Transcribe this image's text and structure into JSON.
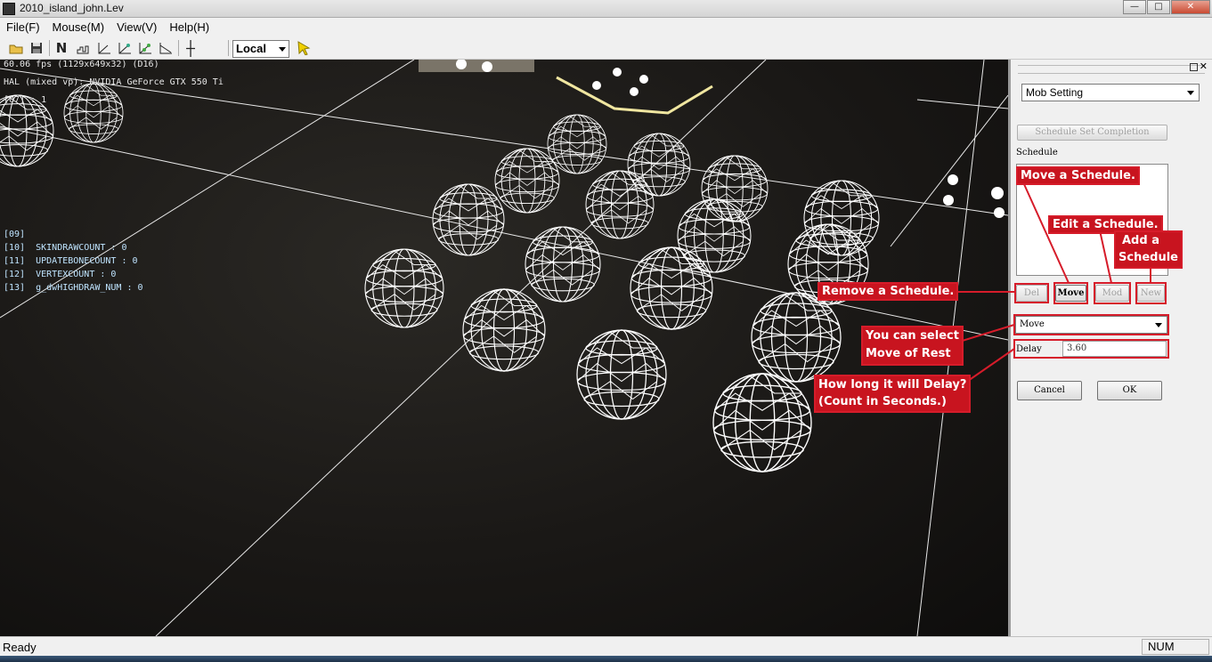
{
  "window": {
    "title": "2010_island_john.Lev",
    "buttons": {
      "minimize": "—",
      "maximize": "□",
      "close": "✕"
    }
  },
  "menu": [
    "File(F)",
    "Mouse(M)",
    "View(V)",
    "Help(H)"
  ],
  "toolbar": {
    "icons": [
      "open-icon",
      "save-icon",
      "north-icon",
      "terrain-icon",
      "axis-icon",
      "axis-2-icon",
      "axis-3-icon",
      "axis-4-icon",
      "cursor-icon"
    ],
    "coord_select": "Local"
  },
  "viewport": {
    "fps_line": "60.06 fps (1129x649x32) (D16)",
    "device_line": "HAL (mixed vp): NVIDIA GeForce GTX 550 Ti",
    "line3": "[07] : 1",
    "debug_lines": [
      "[09]",
      "[10]  SKINDRAWCOUNT : 0",
      "[11]  UPDATEBONECOUNT : 0",
      "[12]  VERTEXCOUNT : 0",
      "[13]  g_dwHIGHDRAW_NUM : 0"
    ]
  },
  "panel": {
    "mode_select": "Mob Setting",
    "schedule_set_completion": "Schedule Set Completion",
    "schedule_label": "Schedule",
    "buttons": {
      "del": "Del",
      "move": "Move",
      "mod": "Mod",
      "new": "New"
    },
    "type_select": "Move",
    "delay_label": "Delay",
    "delay_value": "3.60",
    "cancel": "Cancel",
    "ok": "OK"
  },
  "annotations": {
    "move_schedule": "Move a Schedule.",
    "edit_schedule": "Edit a Schedule.",
    "add_schedule_1": "Add a",
    "add_schedule_2": "Schedule",
    "remove_schedule": "Remove a Schedule.",
    "select_1": "You can select",
    "select_2": "Move of Rest",
    "delay_1": "How long it will Delay?",
    "delay_2": "(Count in Seconds.)"
  },
  "status": {
    "text": "Ready",
    "num": "NUM"
  },
  "colors": {
    "annotation_red": "#c8141f",
    "wireframe": "#ffffff",
    "ground": "#1a1816"
  }
}
